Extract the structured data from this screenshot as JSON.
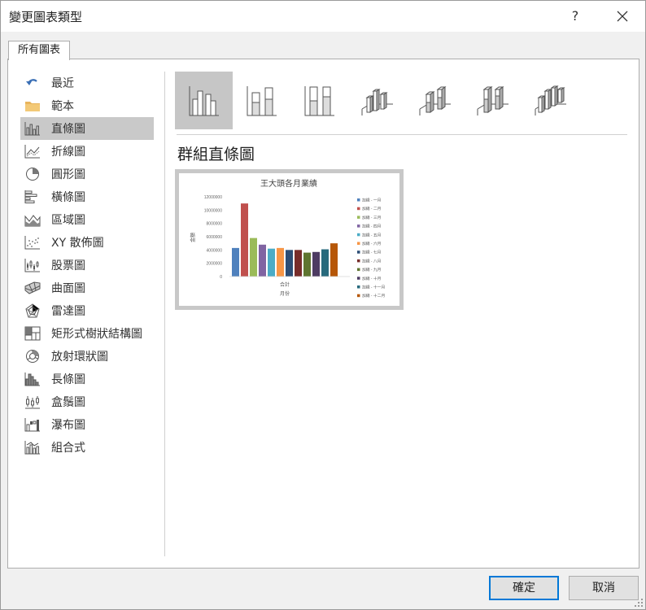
{
  "window": {
    "title": "變更圖表類型",
    "help_label": "?"
  },
  "tabs": [
    {
      "label": "所有圖表"
    }
  ],
  "sidebar": {
    "items": [
      {
        "label": "最近",
        "icon": "recent-icon"
      },
      {
        "label": "範本",
        "icon": "folder-icon"
      },
      {
        "label": "直條圖",
        "icon": "column-chart-icon",
        "selected": true
      },
      {
        "label": "折線圖",
        "icon": "line-chart-icon"
      },
      {
        "label": "圓形圖",
        "icon": "pie-chart-icon"
      },
      {
        "label": "橫條圖",
        "icon": "bar-chart-icon"
      },
      {
        "label": "區域圖",
        "icon": "area-chart-icon"
      },
      {
        "label": "XY 散佈圖",
        "icon": "scatter-chart-icon"
      },
      {
        "label": "股票圖",
        "icon": "stock-chart-icon"
      },
      {
        "label": "曲面圖",
        "icon": "surface-chart-icon"
      },
      {
        "label": "雷達圖",
        "icon": "radar-chart-icon"
      },
      {
        "label": "矩形式樹狀結構圖",
        "icon": "treemap-chart-icon"
      },
      {
        "label": "放射環狀圖",
        "icon": "sunburst-chart-icon"
      },
      {
        "label": "長條圖",
        "icon": "histogram-chart-icon"
      },
      {
        "label": "盒鬚圖",
        "icon": "box-whisker-chart-icon"
      },
      {
        "label": "瀑布圖",
        "icon": "waterfall-chart-icon"
      },
      {
        "label": "組合式",
        "icon": "combo-chart-icon"
      }
    ]
  },
  "subtypes": [
    {
      "icon": "clustered-column-icon",
      "selected": true
    },
    {
      "icon": "stacked-column-icon"
    },
    {
      "icon": "100-stacked-column-icon"
    },
    {
      "icon": "3d-clustered-column-icon"
    },
    {
      "icon": "3d-stacked-column-icon"
    },
    {
      "icon": "3d-100-stacked-column-icon"
    },
    {
      "icon": "3d-column-icon"
    }
  ],
  "main": {
    "heading": "群組直條圖"
  },
  "chart_data": {
    "type": "bar",
    "title": "王大頭各月業績",
    "xlabel": "月份",
    "ylabel": "金額",
    "categories": [
      "合計"
    ],
    "ylim": [
      0,
      12000000
    ],
    "yticks": [
      "12000000",
      "10000000",
      "8000000",
      "6000000",
      "4000000",
      "2000000",
      "0"
    ],
    "series": [
      {
        "name": "加總 - 一月",
        "values": [
          4300000
        ],
        "color": "#4f81bd"
      },
      {
        "name": "加總 - 二月",
        "values": [
          11000000
        ],
        "color": "#c0504d"
      },
      {
        "name": "加總 - 三月",
        "values": [
          5800000
        ],
        "color": "#9bbb59"
      },
      {
        "name": "加總 - 四月",
        "values": [
          4800000
        ],
        "color": "#8064a2"
      },
      {
        "name": "加總 - 五月",
        "values": [
          4200000
        ],
        "color": "#4bacc6"
      },
      {
        "name": "加總 - 六月",
        "values": [
          4300000
        ],
        "color": "#f79646"
      },
      {
        "name": "加總 - 七月",
        "values": [
          4000000
        ],
        "color": "#2c4d75"
      },
      {
        "name": "加總 - 八月",
        "values": [
          4000000
        ],
        "color": "#772c2a"
      },
      {
        "name": "加總 - 九月",
        "values": [
          3600000
        ],
        "color": "#5f7530"
      },
      {
        "name": "加總 - 十月",
        "values": [
          3700000
        ],
        "color": "#4d3b62"
      },
      {
        "name": "加總 - 十一月",
        "values": [
          4100000
        ],
        "color": "#276a7c"
      },
      {
        "name": "加總 - 十二月",
        "values": [
          5000000
        ],
        "color": "#b65708"
      }
    ]
  },
  "footer": {
    "ok_label": "確定",
    "cancel_label": "取消"
  }
}
